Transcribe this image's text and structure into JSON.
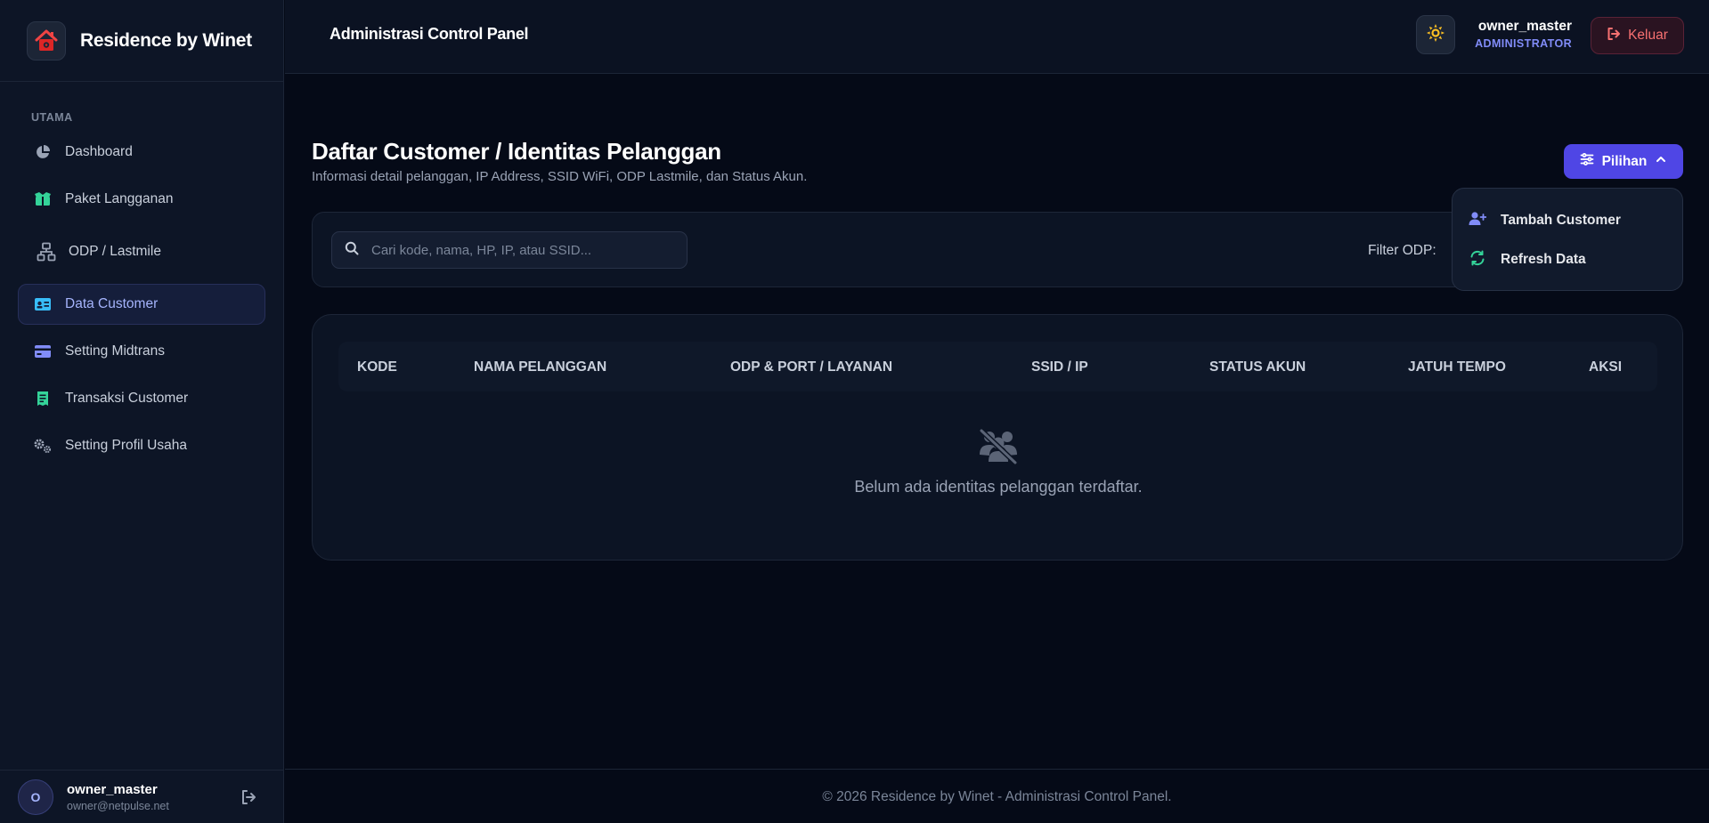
{
  "brand": {
    "name": "Residence by Winet"
  },
  "sidebar": {
    "section_label": "UTAMA",
    "items": [
      {
        "label": "Dashboard",
        "icon": "pie-chart-icon"
      },
      {
        "label": "Paket Langganan",
        "icon": "box-icon"
      },
      {
        "label": "ODP / Lastmile",
        "icon": "network-icon"
      },
      {
        "label": "Data Customer",
        "icon": "id-card-icon",
        "active": true
      },
      {
        "label": "Setting Midtrans",
        "icon": "credit-card-icon"
      },
      {
        "label": "Transaksi Customer",
        "icon": "receipt-icon"
      },
      {
        "label": "Setting Profil Usaha",
        "icon": "gears-icon"
      }
    ],
    "footer": {
      "avatar": "O",
      "name": "owner_master",
      "email": "owner@netpulse.net"
    }
  },
  "topbar": {
    "title": "Administrasi Control Panel",
    "user_name": "owner_master",
    "user_role": "ADMINISTRATOR",
    "logout_label": "Keluar"
  },
  "main": {
    "title": "Daftar Customer / Identitas Pelanggan",
    "subtitle": "Informasi detail pelanggan, IP Address, SSID WiFi, ODP Lastmile, dan Status Akun.",
    "options_button": "Pilihan",
    "dropdown": [
      {
        "label": "Tambah Customer",
        "icon": "user-plus-icon"
      },
      {
        "label": "Refresh Data",
        "icon": "refresh-icon"
      }
    ],
    "search": {
      "placeholder": "Cari kode, nama, HP, IP, atau SSID...",
      "value": ""
    },
    "filter_label": "Filter ODP:",
    "table": {
      "columns": [
        "KODE",
        "NAMA PELANGGAN",
        "ODP & PORT / LAYANAN",
        "SSID / IP",
        "STATUS AKUN",
        "JATUH TEMPO",
        "AKSI"
      ],
      "empty_message": "Belum ada identitas pelanggan terdaftar."
    }
  },
  "footer": {
    "text": "© 2026 Residence by Winet - Administrasi Control Panel."
  },
  "colors": {
    "accent": "#4f46e5",
    "danger": "#f87171",
    "success": "#34d399",
    "background": "#050a17"
  }
}
